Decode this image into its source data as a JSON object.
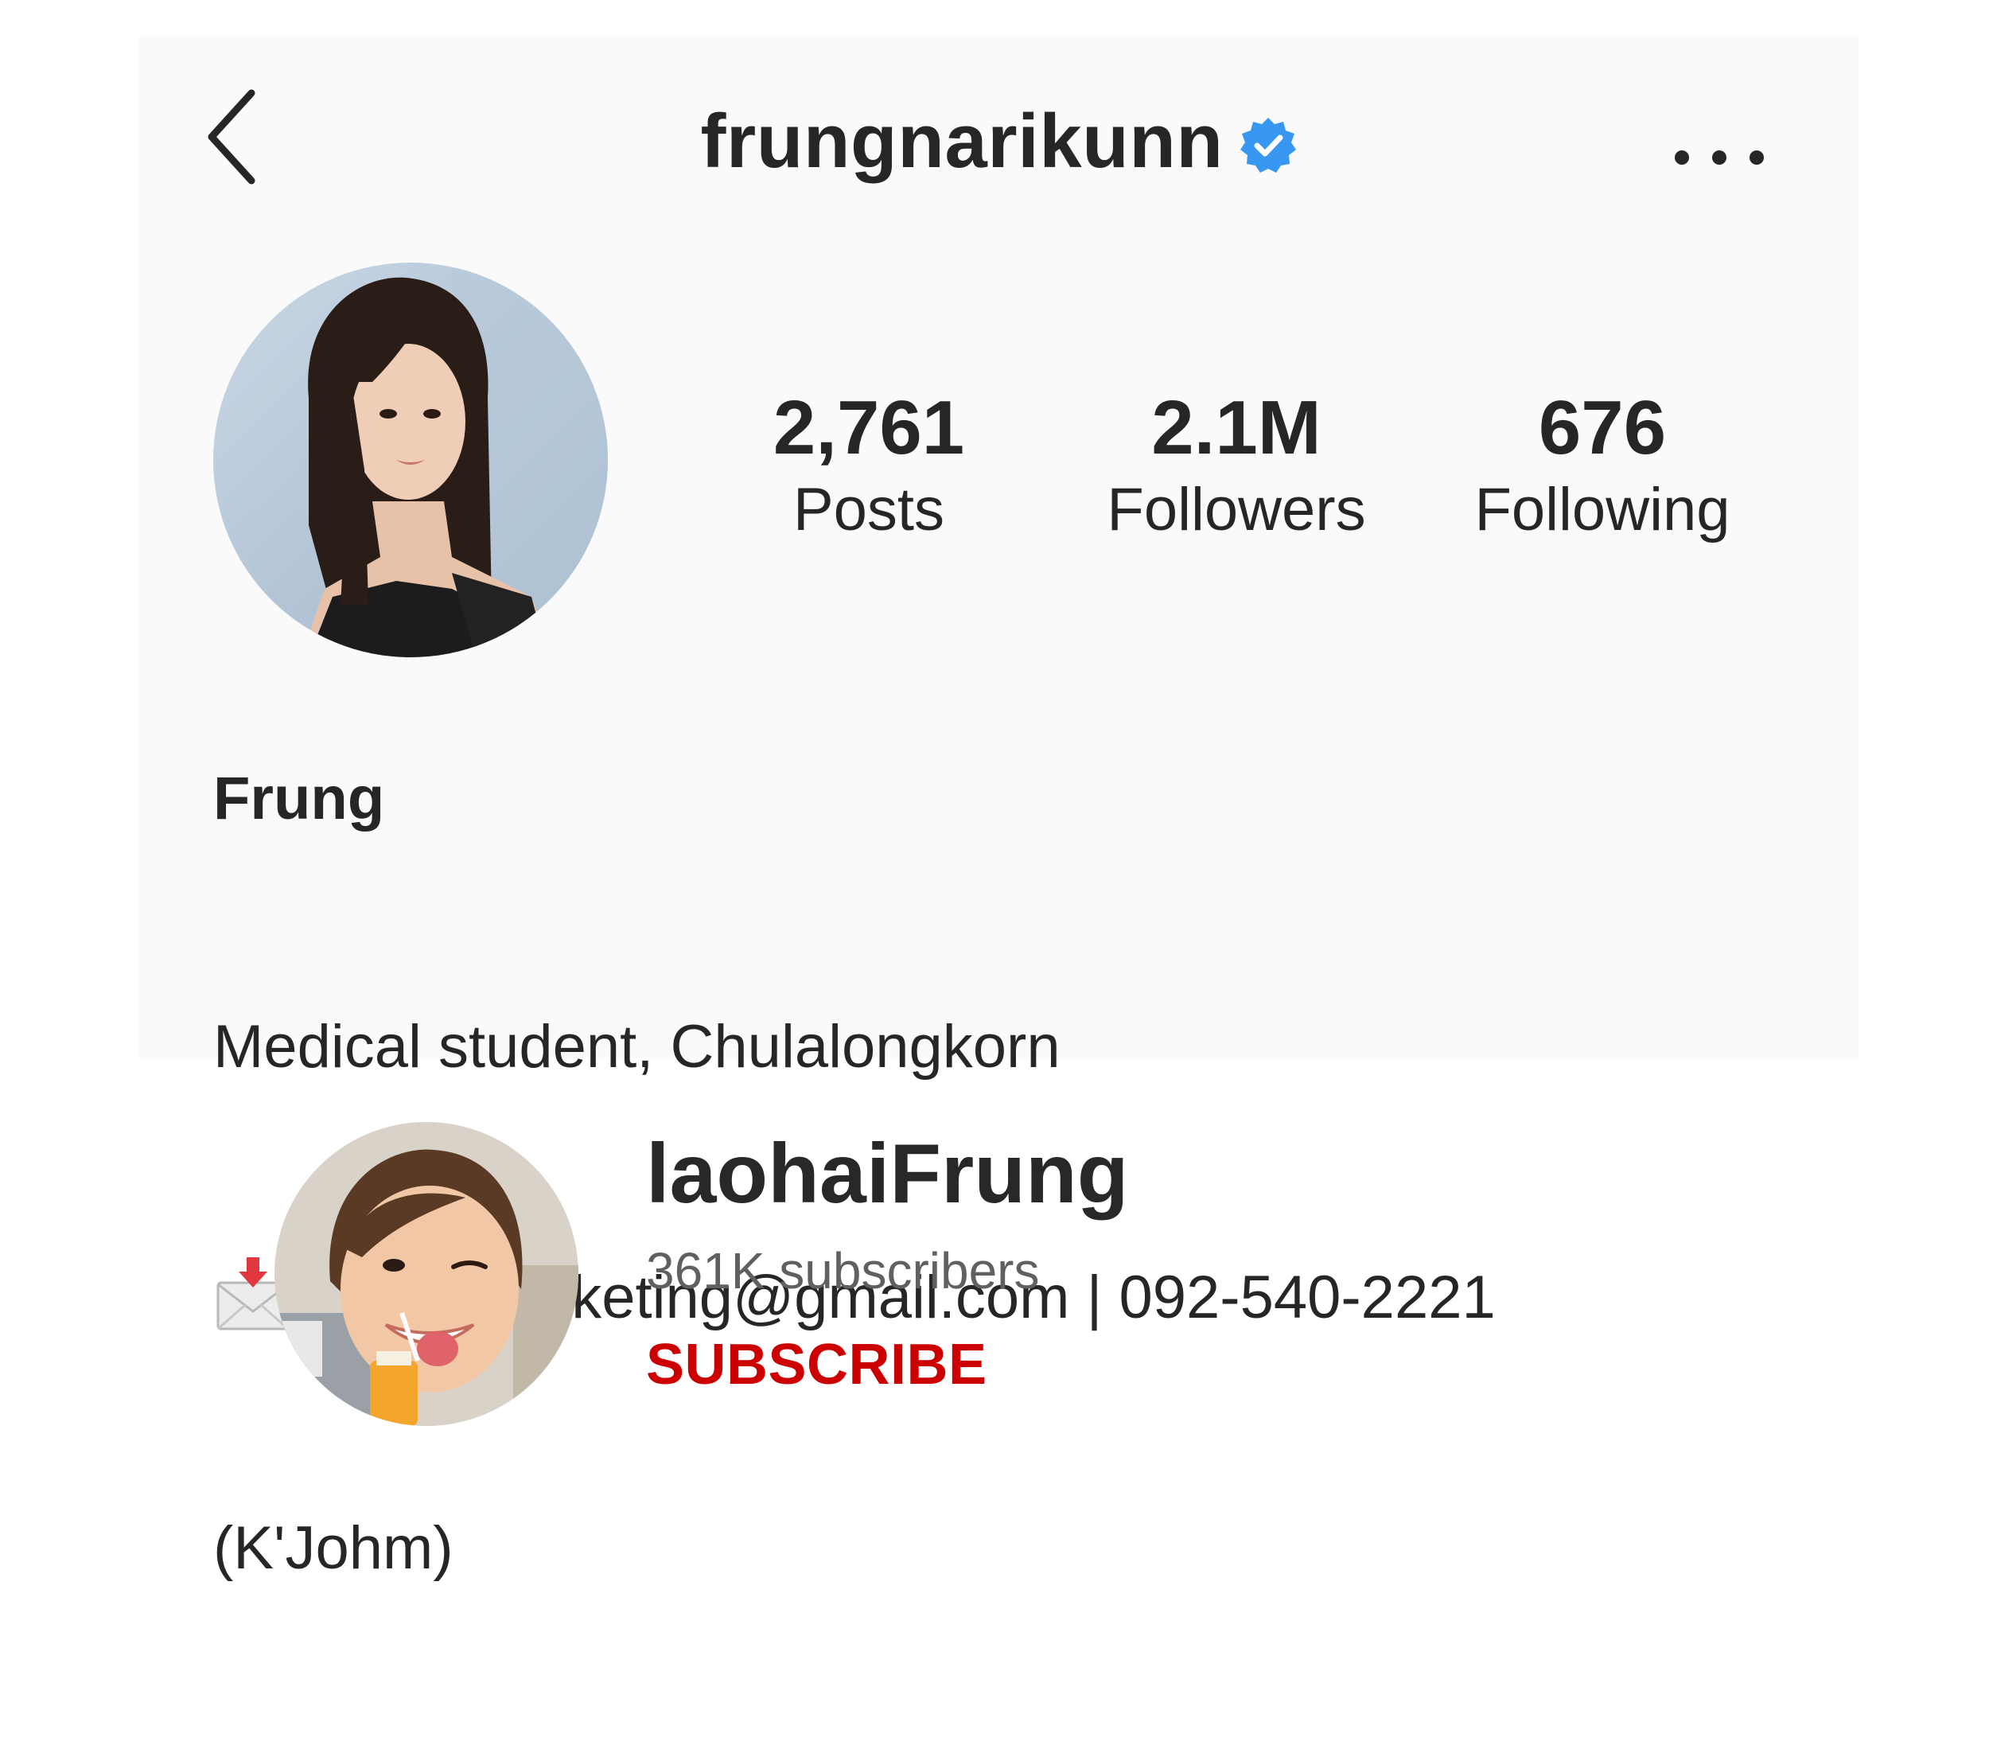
{
  "header": {
    "username": "frungnarikunn",
    "back_icon": "chevron-left-icon",
    "verified_icon": "verified-badge-icon",
    "more_icon": "more-horizontal-icon"
  },
  "stats": {
    "posts": {
      "value": "2,761",
      "label": "Posts"
    },
    "followers": {
      "value": "2.1M",
      "label": "Followers"
    },
    "following": {
      "value": "676",
      "label": "Following"
    }
  },
  "bio": {
    "name": "Frung",
    "line1": "Medical student, Chulalongkorn",
    "line2": "nadaomarketing@gmail.com | 092-540-2221",
    "line3": "(K'Johm)",
    "contact_icon": "envelope-with-arrow-icon"
  },
  "youtube": {
    "channel_name": "laohaiFrung",
    "subscribers": "361K subscribers",
    "subscribe_label": "SUBSCRIBE"
  },
  "colors": {
    "card_background": "#fafafa",
    "text": "#262626",
    "verified_blue": "#3897f0",
    "subscribe_red": "#cc0000",
    "subscribers_gray": "#606060"
  }
}
